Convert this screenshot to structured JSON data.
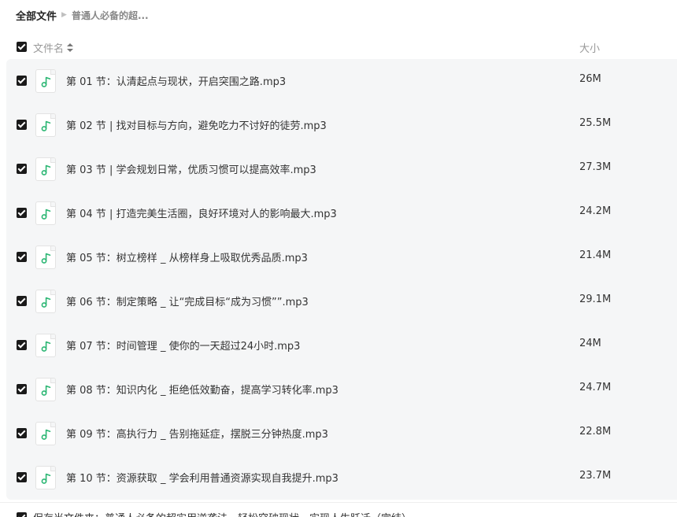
{
  "breadcrumb": {
    "root": "全部文件",
    "current": "普通人必备的超..."
  },
  "header": {
    "name_label": "文件名",
    "size_label": "大小"
  },
  "files": [
    {
      "name": "第 01 节：认清起点与现状，开启突围之路.mp3",
      "size": "26M"
    },
    {
      "name": "第 02 节 | 找对目标与方向，避免吃力不讨好的徒劳.mp3",
      "size": "25.5M"
    },
    {
      "name": "第 03 节 | 学会规划日常，优质习惯可以提高效率.mp3",
      "size": "27.3M"
    },
    {
      "name": "第 04 节 | 打造完美生活圈，良好环境对人的影响最大.mp3",
      "size": "24.2M"
    },
    {
      "name": "第 05 节：树立榜样 _ 从榜样身上吸取优秀品质.mp3",
      "size": "21.4M"
    },
    {
      "name": "第 06 节：制定策略 _ 让“完成目标“成为习惯””.mp3",
      "size": "29.1M"
    },
    {
      "name": "第 07 节：时间管理 _ 使你的一天超过24小时.mp3",
      "size": "24M"
    },
    {
      "name": "第 08 节：知识内化 _ 拒绝低效勤奋，提高学习转化率.mp3",
      "size": "24.7M"
    },
    {
      "name": "第 09 节：高执行力 _ 告别拖延症，摆脱三分钟热度.mp3",
      "size": "22.8M"
    },
    {
      "name": "第 10 节：资源获取 _ 学会利用普通资源实现自我提升.mp3",
      "size": "23.7M"
    }
  ],
  "footer": {
    "text": "保存当文件夹：普通人必备的超实用逆袭法，轻松突破现状，实现人生跃迁（完结）"
  },
  "icons": {
    "file_icon": "music-file-icon",
    "accent": "#2bb673"
  }
}
